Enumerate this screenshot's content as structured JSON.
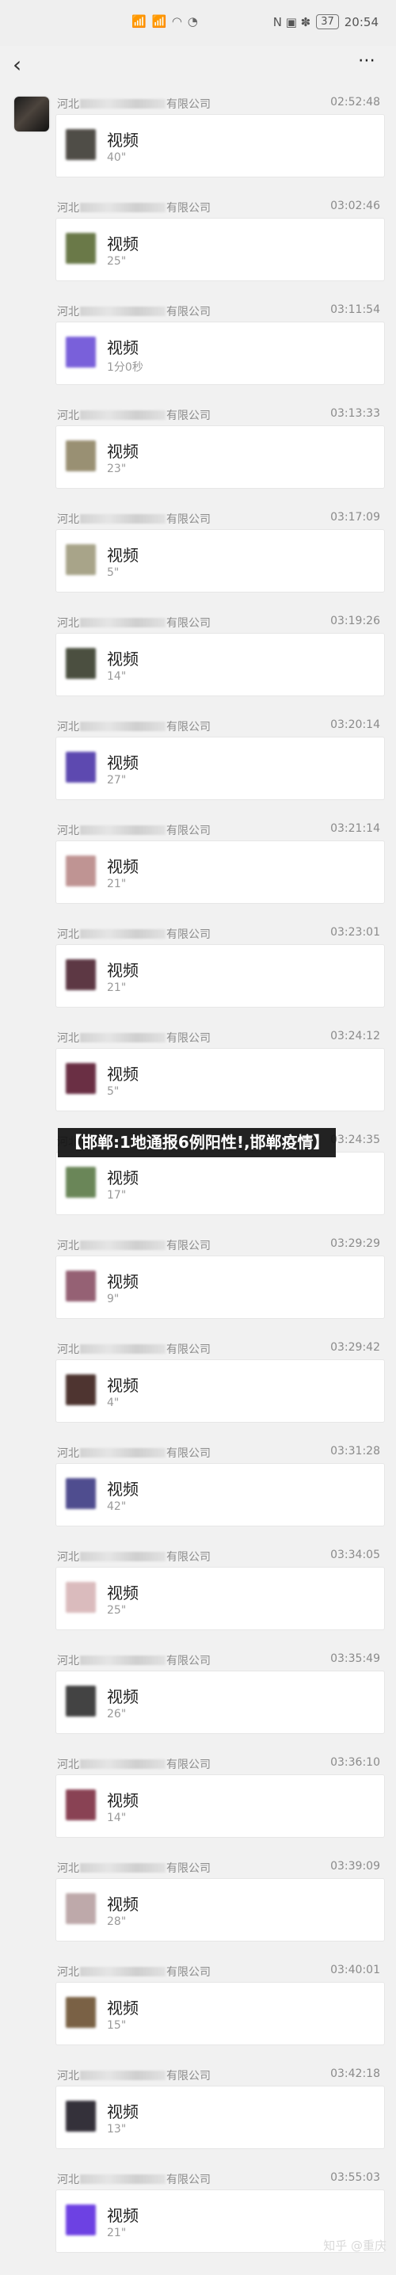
{
  "status_bar": {
    "center_icons": "📶 📶 ◠ ◔",
    "right_icons": "N ▣ ✽",
    "battery": "37",
    "time": "20:54"
  },
  "nav": {
    "back_icon": "‹",
    "more_icon": "⋯"
  },
  "messages": [
    {
      "sender_prefix": "河北",
      "sender_suffix": "有限公司",
      "time": "02:52:48",
      "title": "视频",
      "duration": "40\"",
      "thumb": "#3d3a34"
    },
    {
      "sender_prefix": "河北",
      "sender_suffix": "有限公司",
      "time": "03:02:46",
      "title": "视频",
      "duration": "25\"",
      "thumb": "#5a6b35"
    },
    {
      "sender_prefix": "河北",
      "sender_suffix": "有限公司",
      "time": "03:11:54",
      "title": "视频",
      "duration": "1分0秒",
      "thumb": "#6b4fd6"
    },
    {
      "sender_prefix": "河北",
      "sender_suffix": "有限公司",
      "time": "03:13:33",
      "title": "视频",
      "duration": "23\"",
      "thumb": "#8f8464"
    },
    {
      "sender_prefix": "河北",
      "sender_suffix": "有限公司",
      "time": "03:17:09",
      "title": "视频",
      "duration": "5\"",
      "thumb": "#9f9b7d"
    },
    {
      "sender_prefix": "河北",
      "sender_suffix": "有限公司",
      "time": "03:19:26",
      "title": "视频",
      "duration": "14\"",
      "thumb": "#383d2c"
    },
    {
      "sender_prefix": "河北",
      "sender_suffix": "有限公司",
      "time": "03:20:14",
      "title": "视频",
      "duration": "27\"",
      "thumb": "#4c36a8"
    },
    {
      "sender_prefix": "河北",
      "sender_suffix": "有限公司",
      "time": "03:21:14",
      "title": "视频",
      "duration": "21\"",
      "thumb": "#b98988"
    },
    {
      "sender_prefix": "河北",
      "sender_suffix": "有限公司",
      "time": "03:23:01",
      "title": "视频",
      "duration": "21\"",
      "thumb": "#4c2330"
    },
    {
      "sender_prefix": "河北",
      "sender_suffix": "有限公司",
      "time": "03:24:12",
      "title": "视频",
      "duration": "5\"",
      "thumb": "#5a1930"
    },
    {
      "sender_prefix": "河北",
      "sender_suffix": "有限公司",
      "time": "03:24:35",
      "title": "视频",
      "duration": "17\"",
      "thumb": "#5a7a47"
    },
    {
      "sender_prefix": "河北",
      "sender_suffix": "有限公司",
      "time": "03:29:29",
      "title": "视频",
      "duration": "9\"",
      "thumb": "#8a5065"
    },
    {
      "sender_prefix": "河北",
      "sender_suffix": "有限公司",
      "time": "03:29:42",
      "title": "视频",
      "duration": "4\"",
      "thumb": "#3b1f1a"
    },
    {
      "sender_prefix": "河北",
      "sender_suffix": "有限公司",
      "time": "03:31:28",
      "title": "视频",
      "duration": "42\"",
      "thumb": "#3d3a83"
    },
    {
      "sender_prefix": "河北",
      "sender_suffix": "有限公司",
      "time": "03:34:05",
      "title": "视频",
      "duration": "25\"",
      "thumb": "#d7b4b6"
    },
    {
      "sender_prefix": "河北",
      "sender_suffix": "有限公司",
      "time": "03:35:49",
      "title": "视频",
      "duration": "26\"",
      "thumb": "#2f2f2f"
    },
    {
      "sender_prefix": "河北",
      "sender_suffix": "有限公司",
      "time": "03:36:10",
      "title": "视频",
      "duration": "14\"",
      "thumb": "#7d2e42"
    },
    {
      "sender_prefix": "河北",
      "sender_suffix": "有限公司",
      "time": "03:39:09",
      "title": "视频",
      "duration": "28\"",
      "thumb": "#b7a0a1"
    },
    {
      "sender_prefix": "河北",
      "sender_suffix": "有限公司",
      "time": "03:40:01",
      "title": "视频",
      "duration": "15\"",
      "thumb": "#6c5131"
    },
    {
      "sender_prefix": "河北",
      "sender_suffix": "有限公司",
      "time": "03:42:18",
      "title": "视频",
      "duration": "13\"",
      "thumb": "#1f1b25"
    },
    {
      "sender_prefix": "河北",
      "sender_suffix": "有限公司",
      "time": "03:55:03",
      "title": "视频",
      "duration": "21\"",
      "thumb": "#5e2de0"
    }
  ],
  "overlay_text": "【邯郸:1地通报6例阳性!,邯郸疫情】",
  "watermark": "知乎 @重庆"
}
